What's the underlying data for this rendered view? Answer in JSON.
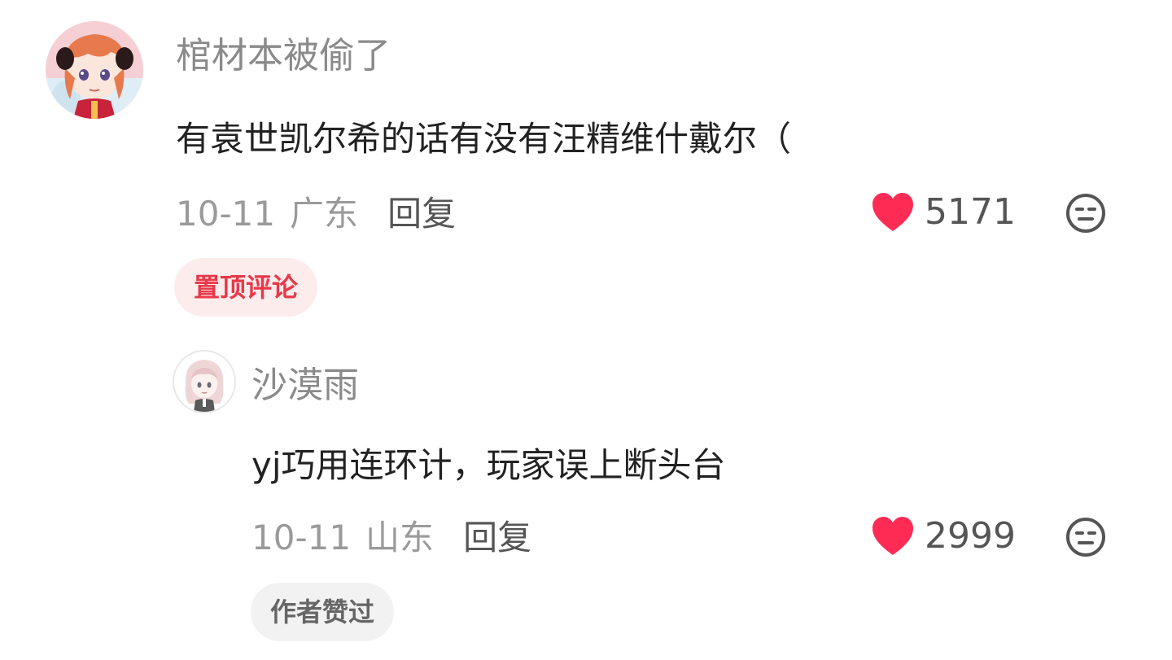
{
  "colors": {
    "accent_red": "#fe2c55",
    "pinned_badge_text": "#e8394a",
    "pinned_badge_bg": "#fdecec",
    "author_badge_bg": "#f2f2f2",
    "username_gray": "#8a8a8a",
    "meta_gray": "#9a9a9a"
  },
  "comment": {
    "avatar_icon": "anime-girl-avatar-orange-hair",
    "username": "棺材本被偷了",
    "text": "有袁世凯尔希的话有没有汪精维什戴尔（",
    "date": "10-11",
    "location": "广东",
    "reply_label": "回复",
    "likes": "5171",
    "like_icon": "heart-icon",
    "dislike_icon": "unamused-face-icon",
    "badge": "置顶评论"
  },
  "reply": {
    "avatar_icon": "anime-girl-avatar-pink-hair",
    "username": "沙漠雨",
    "text": "yj巧用连环计，玩家误上断头台",
    "date": "10-11",
    "location": "山东",
    "reply_label": "回复",
    "likes": "2999",
    "like_icon": "heart-icon",
    "dislike_icon": "unamused-face-icon",
    "badge": "作者赞过"
  }
}
